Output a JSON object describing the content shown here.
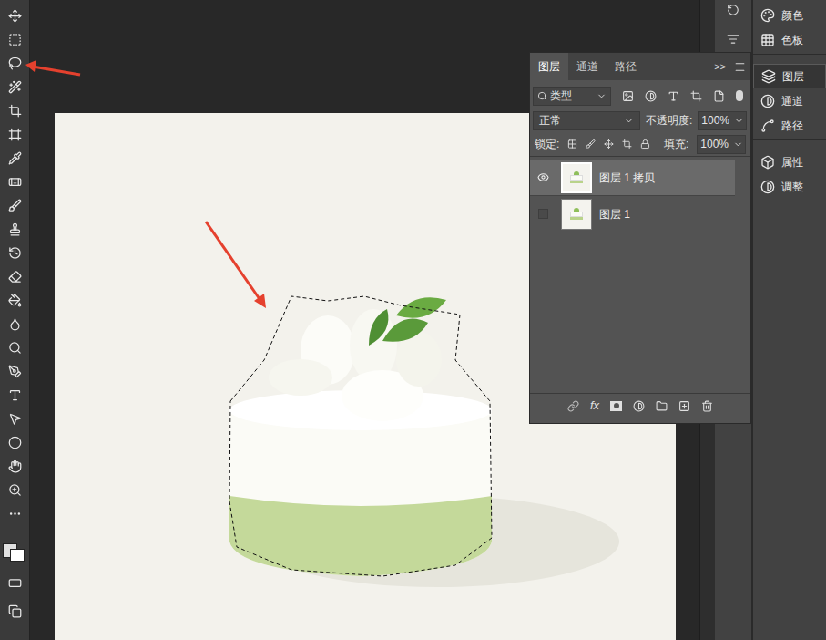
{
  "layers_panel": {
    "tabs": [
      {
        "label": "图层",
        "selected": true
      },
      {
        "label": "通道",
        "selected": false
      },
      {
        "label": "路径",
        "selected": false
      }
    ],
    "collapse_glyph": ">>",
    "filter": {
      "label": "类型"
    },
    "blend_mode": "正常",
    "opacity": {
      "label": "不透明度:",
      "value": "100%"
    },
    "lock": {
      "label": "锁定:"
    },
    "fill": {
      "label": "填充:",
      "value": "100%"
    },
    "layers": [
      {
        "name": "图层 1 拷贝",
        "visible": true,
        "selected": true
      },
      {
        "name": "图层 1",
        "visible": false,
        "selected": false
      }
    ],
    "footer": {
      "fx": "fx"
    }
  },
  "side_panels": [
    {
      "items": [
        {
          "label": "颜色",
          "selected": false
        },
        {
          "label": "色板",
          "selected": false
        }
      ]
    },
    {
      "items": [
        {
          "label": "图层",
          "selected": true
        },
        {
          "label": "通道",
          "selected": false
        },
        {
          "label": "路径",
          "selected": false
        }
      ]
    },
    {
      "items": [
        {
          "label": "属性",
          "selected": false
        },
        {
          "label": "调整",
          "selected": false
        }
      ]
    }
  ]
}
